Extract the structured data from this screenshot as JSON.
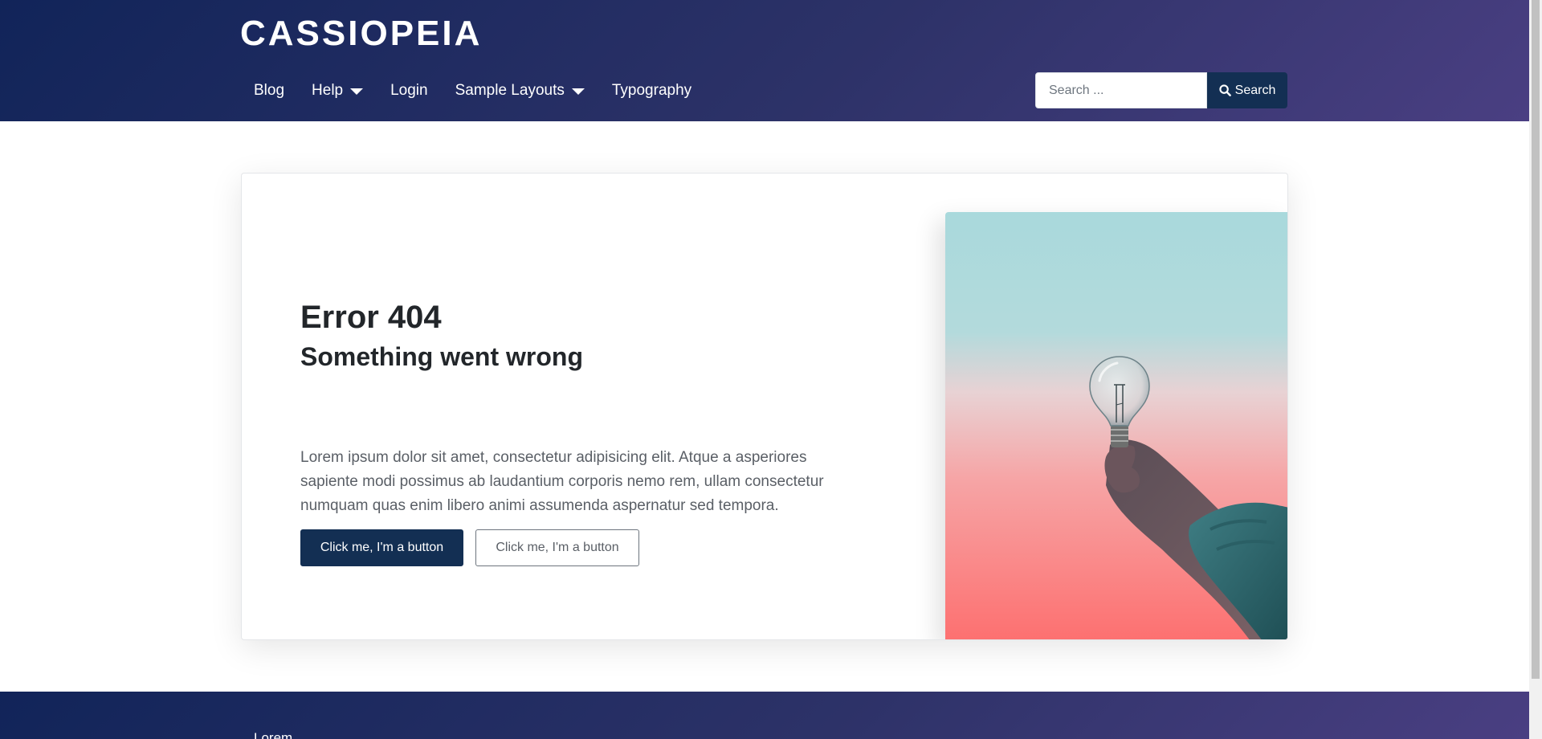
{
  "site": {
    "brand": "CASSIOPEIA"
  },
  "nav": {
    "items": [
      {
        "label": "Blog",
        "has_dropdown": false
      },
      {
        "label": "Help",
        "has_dropdown": true
      },
      {
        "label": "Login",
        "has_dropdown": false
      },
      {
        "label": "Sample Layouts",
        "has_dropdown": true
      },
      {
        "label": "Typography",
        "has_dropdown": false
      }
    ]
  },
  "search": {
    "placeholder": "Search ...",
    "value": "",
    "button_label": "Search"
  },
  "main": {
    "title": "Error 404",
    "subtitle": "Something went wrong",
    "body": "Lorem ipsum dolor sit amet, consectetur adipisicing elit. Atque a asperiores sapiente modi possimus ab laudantium corporis nemo rem, ullam consectetur numquam quas enim libero animi assumenda aspernatur sed tempora.",
    "primary_button": "Click me, I'm a button",
    "secondary_button": "Click me, I'm a button"
  },
  "footer": {
    "text": "Lorem"
  },
  "colors": {
    "header_gradient_start": "#112459",
    "header_gradient_end": "#4a3f82",
    "primary_button": "#132f53",
    "text_dark": "#22262a",
    "text_muted": "#5a5f66"
  },
  "icons": {
    "search_button_icon": "search-icon",
    "dropdown_icon": "caret-down-icon"
  }
}
